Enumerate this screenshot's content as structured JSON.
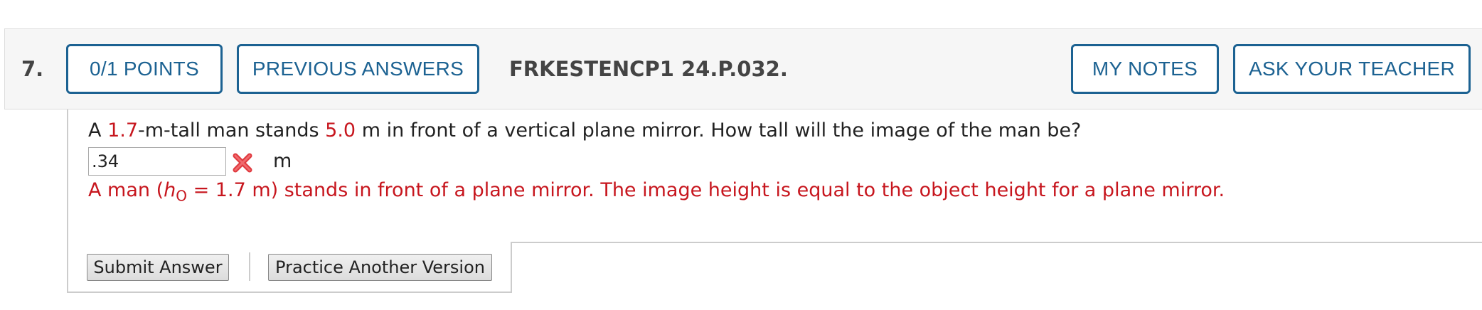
{
  "header": {
    "question_number": "7.",
    "points_label": "0/1 POINTS",
    "previous_answers_label": "PREVIOUS ANSWERS",
    "question_id": "FRKESTENCP1 24.P.032.",
    "my_notes_label": "MY NOTES",
    "ask_teacher_label": "ASK YOUR TEACHER"
  },
  "question": {
    "prompt_part1": "A ",
    "value1": "1.7",
    "prompt_part2": "-m-tall man stands ",
    "value2": "5.0",
    "prompt_part3": " m in front of a vertical plane mirror. How tall will the image of the man be?"
  },
  "answer": {
    "value": ".34",
    "status_icon": "incorrect-x-icon",
    "unit": "m"
  },
  "feedback": {
    "part1": "A man (",
    "symbol": "h",
    "subscript": "O",
    "part2": " = 1.7 m) stands in front of a plane mirror. The image height is equal to the object height for a plane mirror."
  },
  "actions": {
    "submit_label": "Submit Answer",
    "practice_label": "Practice Another Version"
  },
  "colors": {
    "accent": "#1c6292",
    "error": "#c7161e"
  }
}
